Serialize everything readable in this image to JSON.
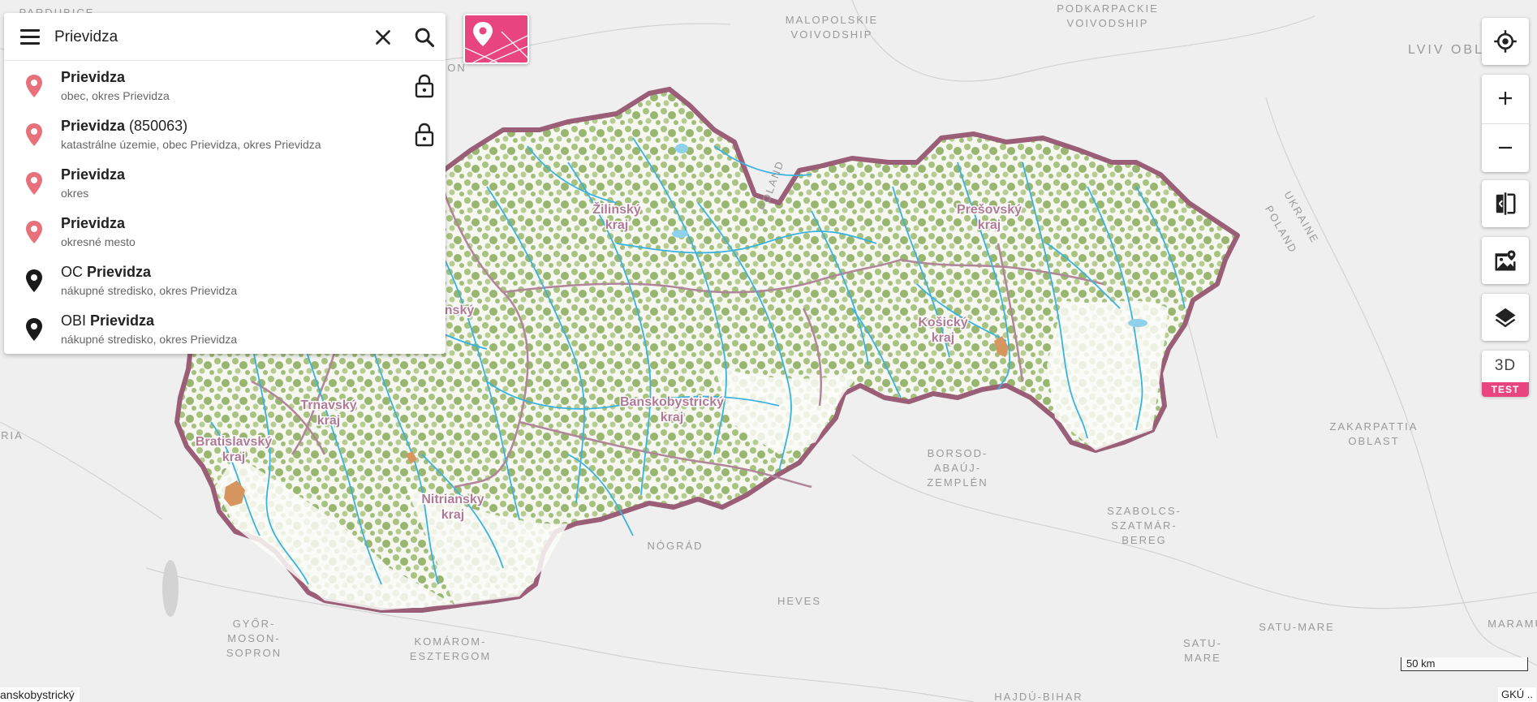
{
  "search": {
    "value": "Prievidza",
    "results": [
      {
        "prefix": "",
        "match": "Prievidza",
        "suffix": "",
        "subtitle": "obec, okres Prievidza",
        "pin": "red",
        "locked": true
      },
      {
        "prefix": "",
        "match": "Prievidza",
        "suffix": " (850063)",
        "subtitle": "katastrálne územie, obec Prievidza, okres Prievidza",
        "pin": "red",
        "locked": true
      },
      {
        "prefix": "",
        "match": "Prievidza",
        "suffix": "",
        "subtitle": "okres",
        "pin": "red",
        "locked": false
      },
      {
        "prefix": "",
        "match": "Prievidza",
        "suffix": "",
        "subtitle": "okresné mesto",
        "pin": "red",
        "locked": false
      },
      {
        "prefix": "OC ",
        "match": "Prievidza",
        "suffix": "",
        "subtitle": "nákupné stredisko, okres Prievidza",
        "pin": "black",
        "locked": false
      },
      {
        "prefix": "OBI ",
        "match": "Prievidza",
        "suffix": "",
        "subtitle": "nákupné stredisko, okres Prievidza",
        "pin": "black",
        "locked": false
      }
    ]
  },
  "map": {
    "region_labels": [
      {
        "line1": "Žilinský",
        "line2": "kraj"
      },
      {
        "line1": "Prešovský",
        "line2": "kraj"
      },
      {
        "line1": "Košický",
        "line2": "kraj"
      },
      {
        "line1": "Banskobystrický",
        "line2": "kraj"
      },
      {
        "line1": "Trnavský",
        "line2": "kraj"
      },
      {
        "line1": "Bratislavský",
        "line2": "kraj"
      },
      {
        "line1": "Nitriansky",
        "line2": "kraj"
      },
      {
        "line1": "nský",
        "line2": ""
      }
    ],
    "area_labels": [
      [
        "PARDUBICE"
      ],
      [
        "MALOPOLSKIE",
        "VOIVODSHIP"
      ],
      [
        "PODKARPACKIE",
        "VOIVODSHIP"
      ],
      [
        "LVIV OBL"
      ],
      [
        "ON"
      ],
      [
        "RIA"
      ],
      [
        "ZAKARPATTIA",
        "OBLAST"
      ],
      [
        "BORSOD-",
        "ABAÚJ-",
        "ZEMPLÉN"
      ],
      [
        "SZABOLCS-",
        "SZATMÁR-",
        "BEREG"
      ],
      [
        "NÓGRÁD"
      ],
      [
        "HEVES"
      ],
      [
        "GYŐR-",
        "MOSON-",
        "SOPRON"
      ],
      [
        "KOMÁROM-",
        "ESZTERGOM"
      ],
      [
        "SATU-MARE"
      ],
      [
        "SATU-",
        "MARE"
      ],
      [
        "MARAMU"
      ],
      [
        "HAJDÚ-BIHAR"
      ],
      [
        "UKRAINE"
      ],
      [
        "POLAND"
      ],
      [
        "POLAND"
      ]
    ],
    "colors": {
      "background": "#efefef",
      "border": "#9a5f77",
      "rivers": "#3ab3e0",
      "forest": "#9fbb77",
      "accent": "#e8457e"
    }
  },
  "controls": {
    "icons": [
      "crosshair-icon",
      "plus-icon",
      "minus-icon",
      "compare-icon",
      "map-settings-icon",
      "layers-icon"
    ],
    "btn_3d": "3D",
    "badge_test": "TEST"
  },
  "scale": {
    "label": "50 km"
  },
  "status": {
    "left": "anskobystrický",
    "right": "GKÚ .."
  }
}
